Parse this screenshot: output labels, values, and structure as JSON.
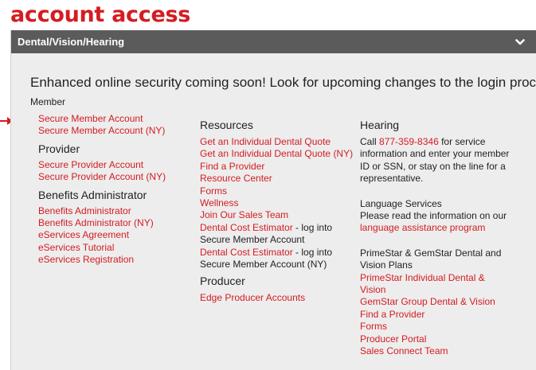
{
  "page": {
    "title": "account access"
  },
  "accordion": {
    "header": "Dental/Vision/Hearing"
  },
  "notice": "Enhanced online security coming soon! Look for upcoming changes to the login process.",
  "member": {
    "label": "Member",
    "links": [
      "Secure Member Account",
      "Secure Member Account (NY)"
    ]
  },
  "provider": {
    "heading": "Provider",
    "links": [
      "Secure Provider Account",
      "Secure Provider Account (NY)"
    ]
  },
  "benefits_admin": {
    "heading": "Benefits Administrator",
    "links": [
      "Benefits Administrator",
      "Benefits Administrator (NY)",
      "eServices Agreement",
      "eServices Tutorial",
      "eServices Registration"
    ]
  },
  "resources": {
    "heading": "Resources",
    "links": [
      "Get an Individual Dental Quote",
      "Get an Individual Dental Quote (NY)",
      "Find a Provider",
      "Resource Center",
      "Forms",
      "Wellness",
      "Join Our Sales Team"
    ],
    "estimator1": {
      "link": "Dental Cost Estimator",
      "text1": " - log into",
      "text2": "Secure Member Account"
    },
    "estimator2": {
      "link": "Dental Cost Estimator",
      "text1": " - log into",
      "text2": "Secure Member Account (NY)"
    }
  },
  "producer": {
    "heading": "Producer",
    "links": [
      "Edge Producer Accounts"
    ]
  },
  "hearing": {
    "heading": "Hearing",
    "call_prefix": "Call ",
    "phone": "877-359-8346",
    "line1_suffix": " for service",
    "line2": "information and enter your member",
    "line3": "ID or SSN, or stay on the line for a",
    "line4": "representative."
  },
  "language": {
    "heading": "Language Services",
    "text": "Please read the information on our",
    "link": "language assistance program"
  },
  "primestar": {
    "heading1": "PrimeStar & GemStar Dental and",
    "heading2": "Vision Plans",
    "link1a": "PrimeStar Individual Dental &",
    "link1b": "Vision",
    "links": [
      "GemStar Group Dental & Vision",
      "Find a Provider",
      "Forms",
      "Producer Portal",
      "Sales Connect Team"
    ]
  },
  "colors": {
    "accent": "#d41c22",
    "header_bg": "#5b5b5b",
    "panel_bg": "#ededed"
  },
  "icons": {
    "header_toggle": "chevron-down-icon",
    "pointer": "arrow-right-icon"
  }
}
